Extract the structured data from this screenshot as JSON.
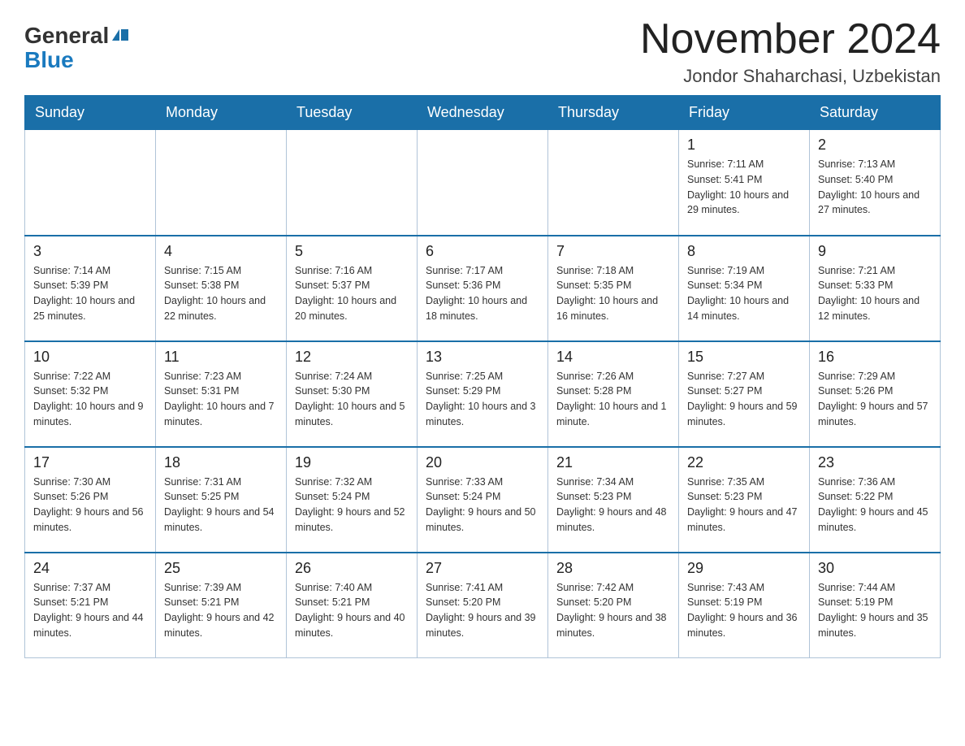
{
  "header": {
    "logo_general": "General",
    "logo_blue": "Blue",
    "month_title": "November 2024",
    "location": "Jondor Shaharchasi, Uzbekistan"
  },
  "weekdays": [
    "Sunday",
    "Monday",
    "Tuesday",
    "Wednesday",
    "Thursday",
    "Friday",
    "Saturday"
  ],
  "weeks": [
    [
      {
        "day": "",
        "sunrise": "",
        "sunset": "",
        "daylight": ""
      },
      {
        "day": "",
        "sunrise": "",
        "sunset": "",
        "daylight": ""
      },
      {
        "day": "",
        "sunrise": "",
        "sunset": "",
        "daylight": ""
      },
      {
        "day": "",
        "sunrise": "",
        "sunset": "",
        "daylight": ""
      },
      {
        "day": "",
        "sunrise": "",
        "sunset": "",
        "daylight": ""
      },
      {
        "day": "1",
        "sunrise": "Sunrise: 7:11 AM",
        "sunset": "Sunset: 5:41 PM",
        "daylight": "Daylight: 10 hours and 29 minutes."
      },
      {
        "day": "2",
        "sunrise": "Sunrise: 7:13 AM",
        "sunset": "Sunset: 5:40 PM",
        "daylight": "Daylight: 10 hours and 27 minutes."
      }
    ],
    [
      {
        "day": "3",
        "sunrise": "Sunrise: 7:14 AM",
        "sunset": "Sunset: 5:39 PM",
        "daylight": "Daylight: 10 hours and 25 minutes."
      },
      {
        "day": "4",
        "sunrise": "Sunrise: 7:15 AM",
        "sunset": "Sunset: 5:38 PM",
        "daylight": "Daylight: 10 hours and 22 minutes."
      },
      {
        "day": "5",
        "sunrise": "Sunrise: 7:16 AM",
        "sunset": "Sunset: 5:37 PM",
        "daylight": "Daylight: 10 hours and 20 minutes."
      },
      {
        "day": "6",
        "sunrise": "Sunrise: 7:17 AM",
        "sunset": "Sunset: 5:36 PM",
        "daylight": "Daylight: 10 hours and 18 minutes."
      },
      {
        "day": "7",
        "sunrise": "Sunrise: 7:18 AM",
        "sunset": "Sunset: 5:35 PM",
        "daylight": "Daylight: 10 hours and 16 minutes."
      },
      {
        "day": "8",
        "sunrise": "Sunrise: 7:19 AM",
        "sunset": "Sunset: 5:34 PM",
        "daylight": "Daylight: 10 hours and 14 minutes."
      },
      {
        "day": "9",
        "sunrise": "Sunrise: 7:21 AM",
        "sunset": "Sunset: 5:33 PM",
        "daylight": "Daylight: 10 hours and 12 minutes."
      }
    ],
    [
      {
        "day": "10",
        "sunrise": "Sunrise: 7:22 AM",
        "sunset": "Sunset: 5:32 PM",
        "daylight": "Daylight: 10 hours and 9 minutes."
      },
      {
        "day": "11",
        "sunrise": "Sunrise: 7:23 AM",
        "sunset": "Sunset: 5:31 PM",
        "daylight": "Daylight: 10 hours and 7 minutes."
      },
      {
        "day": "12",
        "sunrise": "Sunrise: 7:24 AM",
        "sunset": "Sunset: 5:30 PM",
        "daylight": "Daylight: 10 hours and 5 minutes."
      },
      {
        "day": "13",
        "sunrise": "Sunrise: 7:25 AM",
        "sunset": "Sunset: 5:29 PM",
        "daylight": "Daylight: 10 hours and 3 minutes."
      },
      {
        "day": "14",
        "sunrise": "Sunrise: 7:26 AM",
        "sunset": "Sunset: 5:28 PM",
        "daylight": "Daylight: 10 hours and 1 minute."
      },
      {
        "day": "15",
        "sunrise": "Sunrise: 7:27 AM",
        "sunset": "Sunset: 5:27 PM",
        "daylight": "Daylight: 9 hours and 59 minutes."
      },
      {
        "day": "16",
        "sunrise": "Sunrise: 7:29 AM",
        "sunset": "Sunset: 5:26 PM",
        "daylight": "Daylight: 9 hours and 57 minutes."
      }
    ],
    [
      {
        "day": "17",
        "sunrise": "Sunrise: 7:30 AM",
        "sunset": "Sunset: 5:26 PM",
        "daylight": "Daylight: 9 hours and 56 minutes."
      },
      {
        "day": "18",
        "sunrise": "Sunrise: 7:31 AM",
        "sunset": "Sunset: 5:25 PM",
        "daylight": "Daylight: 9 hours and 54 minutes."
      },
      {
        "day": "19",
        "sunrise": "Sunrise: 7:32 AM",
        "sunset": "Sunset: 5:24 PM",
        "daylight": "Daylight: 9 hours and 52 minutes."
      },
      {
        "day": "20",
        "sunrise": "Sunrise: 7:33 AM",
        "sunset": "Sunset: 5:24 PM",
        "daylight": "Daylight: 9 hours and 50 minutes."
      },
      {
        "day": "21",
        "sunrise": "Sunrise: 7:34 AM",
        "sunset": "Sunset: 5:23 PM",
        "daylight": "Daylight: 9 hours and 48 minutes."
      },
      {
        "day": "22",
        "sunrise": "Sunrise: 7:35 AM",
        "sunset": "Sunset: 5:23 PM",
        "daylight": "Daylight: 9 hours and 47 minutes."
      },
      {
        "day": "23",
        "sunrise": "Sunrise: 7:36 AM",
        "sunset": "Sunset: 5:22 PM",
        "daylight": "Daylight: 9 hours and 45 minutes."
      }
    ],
    [
      {
        "day": "24",
        "sunrise": "Sunrise: 7:37 AM",
        "sunset": "Sunset: 5:21 PM",
        "daylight": "Daylight: 9 hours and 44 minutes."
      },
      {
        "day": "25",
        "sunrise": "Sunrise: 7:39 AM",
        "sunset": "Sunset: 5:21 PM",
        "daylight": "Daylight: 9 hours and 42 minutes."
      },
      {
        "day": "26",
        "sunrise": "Sunrise: 7:40 AM",
        "sunset": "Sunset: 5:21 PM",
        "daylight": "Daylight: 9 hours and 40 minutes."
      },
      {
        "day": "27",
        "sunrise": "Sunrise: 7:41 AM",
        "sunset": "Sunset: 5:20 PM",
        "daylight": "Daylight: 9 hours and 39 minutes."
      },
      {
        "day": "28",
        "sunrise": "Sunrise: 7:42 AM",
        "sunset": "Sunset: 5:20 PM",
        "daylight": "Daylight: 9 hours and 38 minutes."
      },
      {
        "day": "29",
        "sunrise": "Sunrise: 7:43 AM",
        "sunset": "Sunset: 5:19 PM",
        "daylight": "Daylight: 9 hours and 36 minutes."
      },
      {
        "day": "30",
        "sunrise": "Sunrise: 7:44 AM",
        "sunset": "Sunset: 5:19 PM",
        "daylight": "Daylight: 9 hours and 35 minutes."
      }
    ]
  ]
}
